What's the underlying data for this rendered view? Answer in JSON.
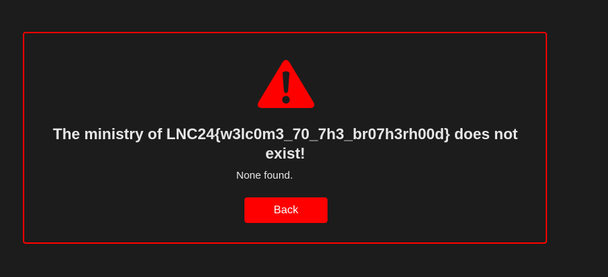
{
  "error": {
    "icon": "warning-triangle-icon",
    "title": "The ministry of LNC24{w3lc0m3_70_7h3_br07h3rh00d} does not exist!",
    "detail": "None found.",
    "back_label": "Back"
  },
  "colors": {
    "background": "#1c1c1c",
    "accent": "#ff0000",
    "text": "#e6e6e6"
  }
}
